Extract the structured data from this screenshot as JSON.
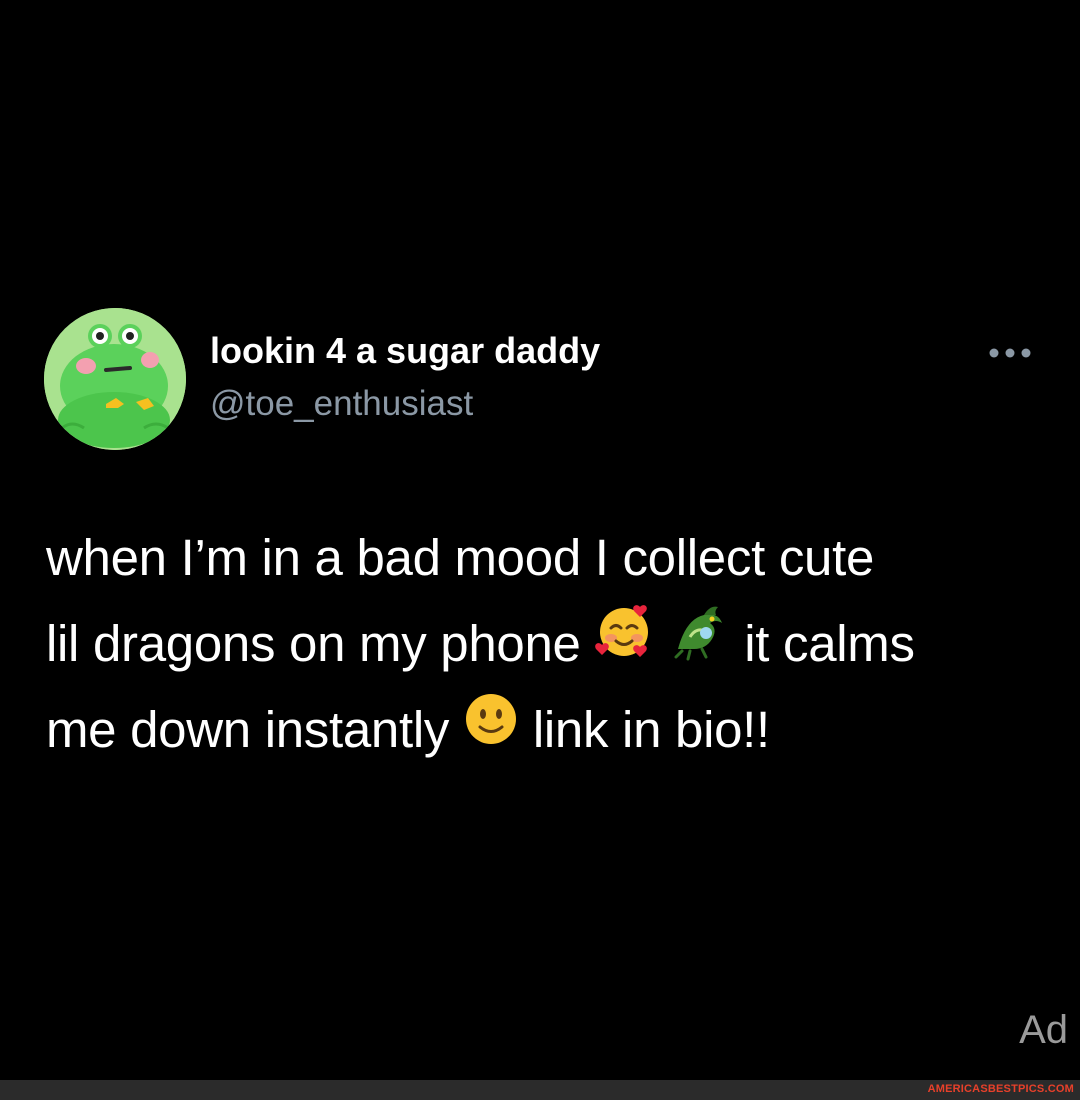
{
  "tweet": {
    "display_name": "lookin 4 a sugar daddy",
    "handle": "@toe_enthusiast",
    "more_icon": "ellipsis-icon",
    "avatar_icon": "frog-avatar",
    "body": {
      "line1": "when I’m in a bad mood I collect cute",
      "line2_before_emoji": "lil dragons on my phone",
      "emoji_1": "smiling-face-with-hearts-emoji",
      "emoji_2": "dragon-emoji",
      "line2_after_emoji": "it calms",
      "line3_before_emoji": "me down instantly",
      "emoji_3": "slightly-smiling-face-emoji",
      "line3_after_emoji": "link in bio!!"
    },
    "ad_label": "Ad"
  },
  "footer": {
    "watermark": "AMERICASBESTPICS.COM"
  },
  "colors": {
    "background": "#000000",
    "text_primary": "#ffffff",
    "text_secondary": "#8b98a5",
    "ad_label": "#9a9a9a",
    "footer_bar": "#2b2b2b",
    "watermark": "#e8402a"
  }
}
